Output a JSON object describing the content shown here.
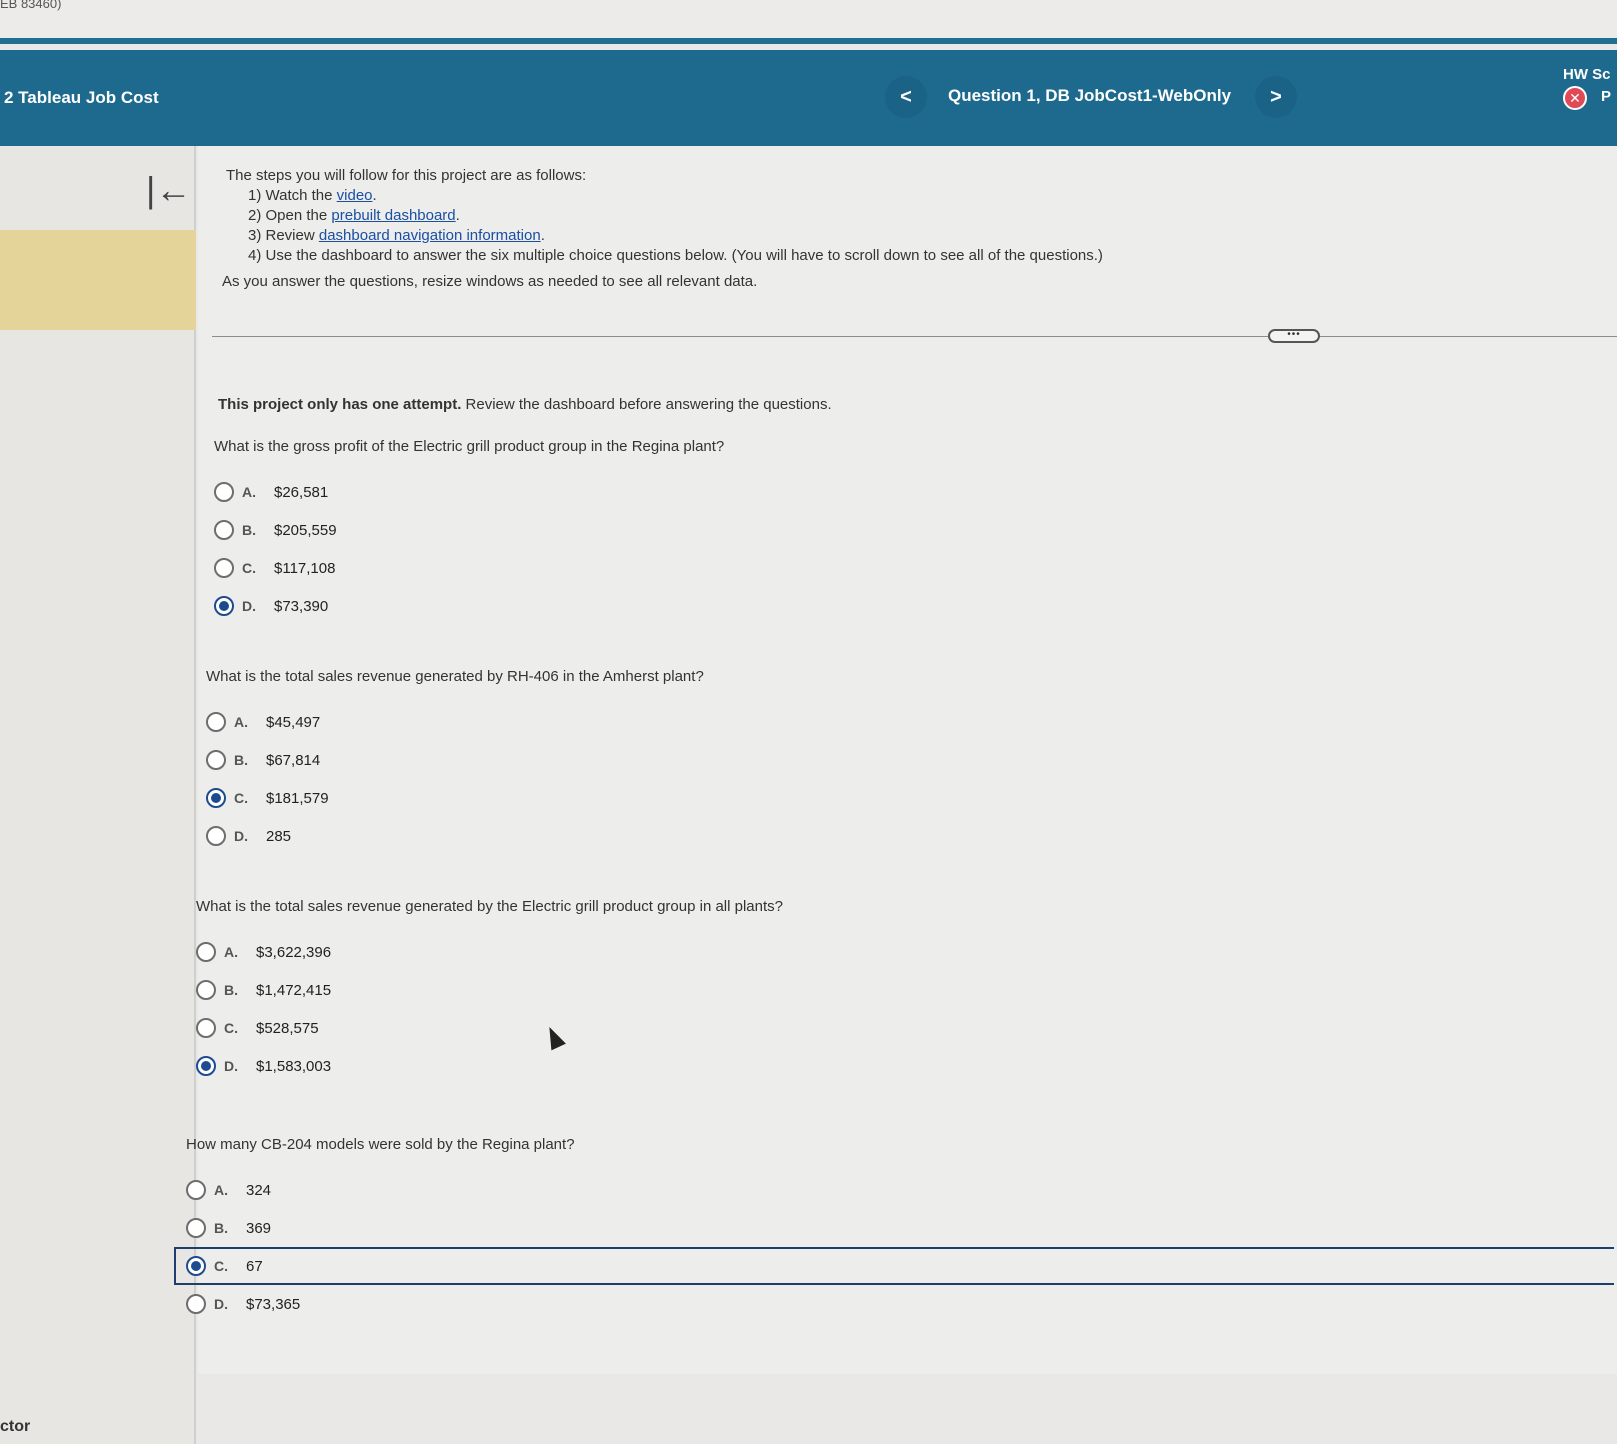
{
  "top_strip": {
    "crumb": "EB 83460)"
  },
  "header": {
    "course": "2 Tableau Job Cost",
    "nav_prev": "<",
    "question_title": "Question 1, DB JobCost1-WebOnly",
    "nav_next": ">",
    "hw_score": "HW Sc",
    "close_glyph": "✕",
    "p_label": "P"
  },
  "sidebar": {
    "collapse_glyph": "|←",
    "bottom_label": "ctor"
  },
  "instructions": {
    "intro": "The steps you will follow for this project are as follows:",
    "step1_prefix": "1) Watch the ",
    "step1_link": "video",
    "step1_suffix": ".",
    "step2_prefix": "2) Open the ",
    "step2_link": "prebuilt dashboard",
    "step2_suffix": ".",
    "step3_prefix": "3) Review ",
    "step3_link": "dashboard navigation information",
    "step3_suffix": ".",
    "step4": "4) Use the dashboard to answer the six multiple choice questions below. (You will have to scroll down to see all of the questions.)",
    "note": "As you answer the questions, resize windows as needed to see all relevant data."
  },
  "more_button": "•••",
  "attempt_note": {
    "bold": "This project only has one attempt.",
    "rest": " Review the dashboard before answering the questions."
  },
  "questions": [
    {
      "prompt": "What is the gross profit of the Electric grill product group in the Regina plant?",
      "options": [
        {
          "letter": "A.",
          "value": "$26,581"
        },
        {
          "letter": "B.",
          "value": "$205,559"
        },
        {
          "letter": "C.",
          "value": "$117,108"
        },
        {
          "letter": "D.",
          "value": "$73,390"
        }
      ],
      "selected": 3
    },
    {
      "prompt": "What is the total sales revenue generated by RH-406 in the Amherst plant?",
      "options": [
        {
          "letter": "A.",
          "value": "$45,497"
        },
        {
          "letter": "B.",
          "value": "$67,814"
        },
        {
          "letter": "C.",
          "value": "$181,579"
        },
        {
          "letter": "D.",
          "value": "285"
        }
      ],
      "selected": 2
    },
    {
      "prompt": "What is the total sales revenue generated by the Electric grill product group in all plants?",
      "options": [
        {
          "letter": "A.",
          "value": "$3,622,396"
        },
        {
          "letter": "B.",
          "value": "$1,472,415"
        },
        {
          "letter": "C.",
          "value": "$528,575"
        },
        {
          "letter": "D.",
          "value": "$1,583,003"
        }
      ],
      "selected": 3
    },
    {
      "prompt": "How many CB-204 models were sold by the Regina plant?",
      "options": [
        {
          "letter": "A.",
          "value": "324"
        },
        {
          "letter": "B.",
          "value": "369"
        },
        {
          "letter": "C.",
          "value": "67"
        },
        {
          "letter": "D.",
          "value": "$73,365"
        }
      ],
      "selected": 2
    }
  ],
  "colors": {
    "header_bg": "#1e6a8e",
    "radio_selected": "#1d4b8f",
    "link": "#1a4fa3",
    "sidebar_highlight": "#e5d49a"
  }
}
